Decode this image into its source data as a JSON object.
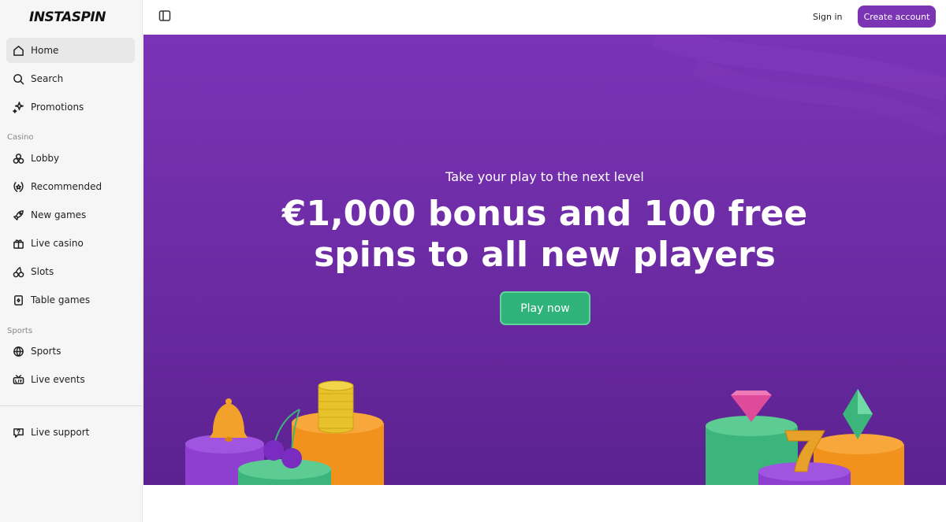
{
  "brand": {
    "logo_text": "INSTASPIN"
  },
  "sidebar": {
    "items": [
      {
        "label": "Home",
        "icon": "home-icon"
      },
      {
        "label": "Search",
        "icon": "search-icon"
      },
      {
        "label": "Promotions",
        "icon": "sparkle-icon"
      }
    ],
    "casino_label": "Casino",
    "casino_items": [
      {
        "label": "Lobby",
        "icon": "shapes-icon"
      },
      {
        "label": "Recommended",
        "icon": "laurel-icon"
      },
      {
        "label": "New games",
        "icon": "rocket-icon"
      },
      {
        "label": "Live casino",
        "icon": "gift-icon"
      },
      {
        "label": "Slots",
        "icon": "cherries-icon"
      },
      {
        "label": "Table games",
        "icon": "cards-icon"
      }
    ],
    "sports_label": "Sports",
    "sports_items": [
      {
        "label": "Sports",
        "icon": "ball-icon"
      },
      {
        "label": "Live events",
        "icon": "live-badge-icon"
      }
    ],
    "support": {
      "label": "Live support",
      "icon": "chat-question-icon"
    }
  },
  "topbar": {
    "signin_label": "Sign in",
    "create_label": "Create account"
  },
  "hero": {
    "subtitle": "Take your play to the next level",
    "title_line1": "€1,000 bonus and 100 free",
    "title_line2": "spins to all new players",
    "cta_label": "Play now"
  },
  "colors": {
    "accent": "#7b34b4",
    "cta_green": "#2fb37a"
  }
}
